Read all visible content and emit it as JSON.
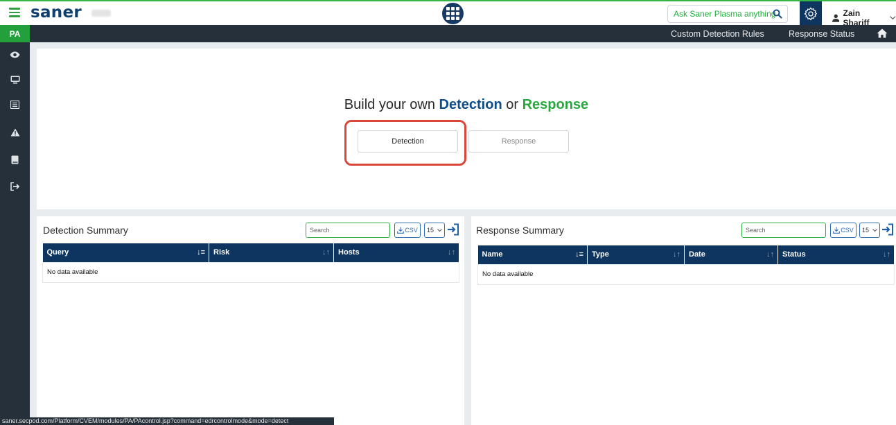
{
  "header": {
    "brand": "saner",
    "ask_placeholder": "Ask Saner Plasma anything !",
    "user_name": "Zain Shariff"
  },
  "sidebar": {
    "module_badge": "PA",
    "icons": [
      "eye-icon",
      "monitor-icon",
      "list-icon",
      "warning-icon",
      "book-icon",
      "sign-out-icon"
    ]
  },
  "subnav": {
    "links": [
      "Custom Detection Rules",
      "Response Status"
    ]
  },
  "builder": {
    "heading_prefix": "Build your own",
    "heading_detection": "Detection",
    "heading_or": "or",
    "heading_response": "Response",
    "detection_button": "Detection",
    "response_button": "Response"
  },
  "detection_summary": {
    "title": "Detection Summary",
    "search_placeholder": "Search",
    "csv_label": "CSV",
    "page_size": "15",
    "columns": [
      "Query",
      "Risk",
      "Hosts"
    ],
    "empty_text": "No data available"
  },
  "response_summary": {
    "title": "Response Summary",
    "search_placeholder": "Search",
    "csv_label": "CSV",
    "page_size": "15",
    "columns": [
      "Name",
      "Type",
      "Date",
      "Status"
    ],
    "empty_text": "No data available"
  },
  "status_url": "saner.secpod.com/Platform/CVEM/modules/PA/PAcontrol.jsp?command=edrcontrolmode&mode=detect",
  "colors": {
    "brand_navy": "#0d3560",
    "accent_green": "#2bab3e",
    "sidebar_dark": "#26303a",
    "highlight_red": "#d8473a"
  }
}
